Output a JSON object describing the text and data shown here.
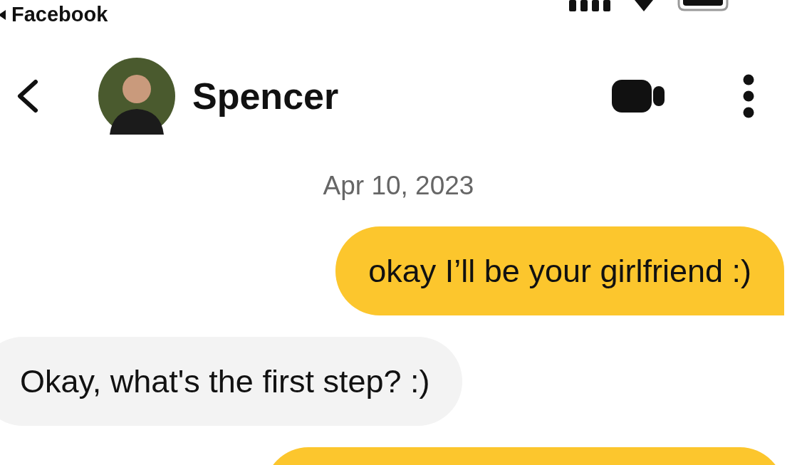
{
  "status_bar": {
    "back_app": "Facebook"
  },
  "header": {
    "contact_name": "Spencer"
  },
  "date_separator": "Apr 10, 2023",
  "messages": [
    {
      "kind": "sent",
      "text": "okay I’ll be your girlfriend :)"
    },
    {
      "kind": "received",
      "text": "Okay, what's the first step? :)"
    },
    {
      "kind": "sent"
    }
  ]
}
